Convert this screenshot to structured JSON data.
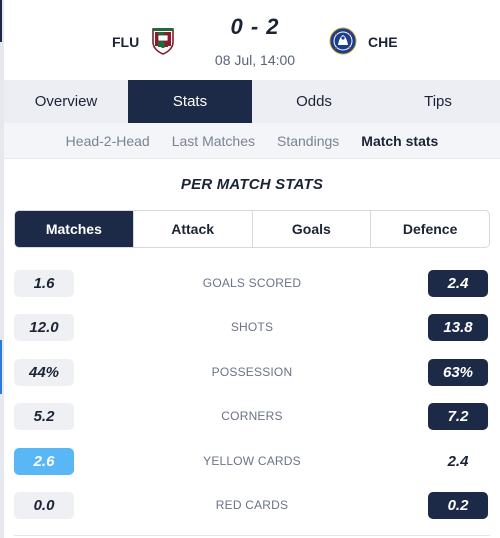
{
  "match": {
    "home_team": "FLU",
    "away_team": "CHE",
    "score": "0 - 2",
    "kickoff": "08 Jul, 14:00",
    "home_crest_icon": "fluminense-crest-icon",
    "away_crest_icon": "chelsea-crest-icon"
  },
  "main_tabs": [
    {
      "label": "Overview",
      "active": false
    },
    {
      "label": "Stats",
      "active": true
    },
    {
      "label": "Odds",
      "active": false
    },
    {
      "label": "Tips",
      "active": false
    }
  ],
  "sub_tabs": [
    {
      "label": "Head-2-Head",
      "active": false
    },
    {
      "label": "Last Matches",
      "active": false
    },
    {
      "label": "Standings",
      "active": false
    },
    {
      "label": "Match stats",
      "active": true
    }
  ],
  "section_title": "PER MATCH STATS",
  "filter_tabs": [
    {
      "label": "Matches",
      "active": true
    },
    {
      "label": "Attack",
      "active": false
    },
    {
      "label": "Goals",
      "active": false
    },
    {
      "label": "Defence",
      "active": false
    }
  ],
  "stats": [
    {
      "label": "GOALS SCORED",
      "home": "1.6",
      "away": "2.4",
      "home_style": "neutral",
      "away_style": "dark"
    },
    {
      "label": "SHOTS",
      "home": "12.0",
      "away": "13.8",
      "home_style": "neutral",
      "away_style": "dark"
    },
    {
      "label": "POSSESSION",
      "home": "44%",
      "away": "63%",
      "home_style": "neutral",
      "away_style": "dark"
    },
    {
      "label": "CORNERS",
      "home": "5.2",
      "away": "7.2",
      "home_style": "neutral",
      "away_style": "dark"
    },
    {
      "label": "YELLOW CARDS",
      "home": "2.6",
      "away": "2.4",
      "home_style": "light",
      "away_style": "plain"
    },
    {
      "label": "RED CARDS",
      "home": "0.0",
      "away": "0.2",
      "home_style": "neutral",
      "away_style": "dark"
    }
  ],
  "colors": {
    "navy": "#1c2a47",
    "light_blue": "#59b7f5",
    "neutral_pill": "#eef0f4"
  }
}
